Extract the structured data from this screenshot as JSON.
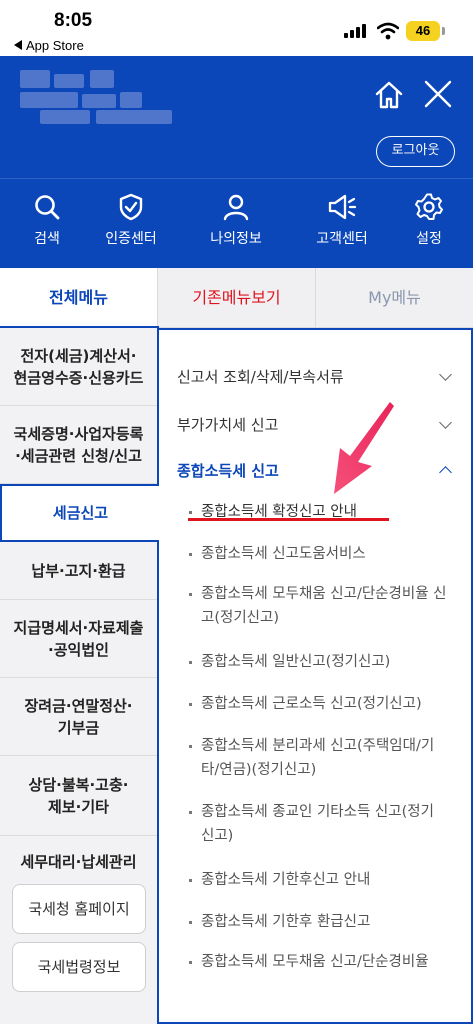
{
  "status_bar": {
    "time": "8:05",
    "back_label": "App Store",
    "battery": "46"
  },
  "header": {
    "logout_label": "로그아웃"
  },
  "quick_menu": [
    {
      "label": "검색",
      "icon": "search-icon"
    },
    {
      "label": "인증센터",
      "icon": "shield-icon"
    },
    {
      "label": "나의정보",
      "icon": "user-icon"
    },
    {
      "label": "고객센터",
      "icon": "megaphone-icon"
    },
    {
      "label": "설정",
      "icon": "gear-icon"
    }
  ],
  "tabs": {
    "all": "전체메뉴",
    "old": "기존메뉴보기",
    "my": "My메뉴"
  },
  "left_menu": {
    "items": [
      "전자(세금)계산서·\n현금영수증·신용카드",
      "국세증명·사업자등록\n·세금관련 신청/신고",
      "세금신고",
      "납부·고지·환급",
      "지급명세서·자료제출\n·공익법인",
      "장려금·연말정산·\n기부금",
      "상담·불복·고충·\n제보·기타",
      "세무대리·납세관리"
    ],
    "buttons": [
      "국세청 홈페이지",
      "국세법령정보"
    ]
  },
  "right_menu": {
    "sections": [
      {
        "label": "신고서 조회/삭제/부속서류",
        "expanded": false
      },
      {
        "label": "부가가치세 신고",
        "expanded": false
      },
      {
        "label": "종합소득세 신고",
        "expanded": true
      }
    ],
    "sub_items": [
      "종합소득세 확정신고 안내",
      "종합소득세 신고도움서비스",
      "종합소득세 모두채움 신고/단순경비율 신고(정기신고)",
      "종합소득세 일반신고(정기신고)",
      "종합소득세 근로소득 신고(정기신고)",
      "종합소득세 분리과세 신고(주택임대/기타/연금)(정기신고)",
      "종합소득세 종교인 기타소득 신고(정기신고)",
      "종합소득세 기한후신고 안내",
      "종합소득세 기한후 환급신고",
      "종합소득세 모두채움 신고/단순경비율"
    ]
  },
  "colors": {
    "brand_blue": "#0c47b9",
    "accent_red": "#e0141e",
    "arrow_pink": "#f0305a"
  }
}
